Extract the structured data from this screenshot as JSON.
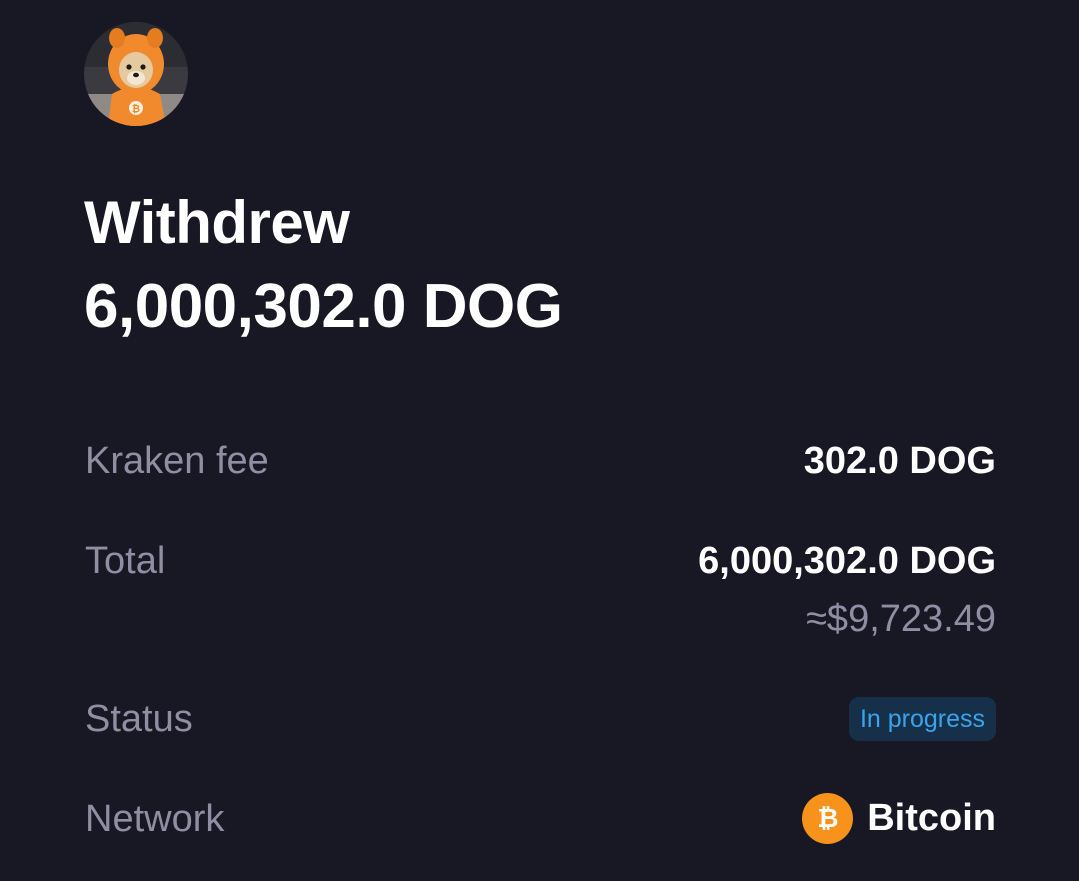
{
  "header": {
    "avatar_icon": "dog-in-orange-bitcoin-hoodie-avatar",
    "title": "Withdrew",
    "amount": "6,000,302.0 DOG"
  },
  "details": {
    "fee": {
      "label": "Kraken fee",
      "value": "302.0 DOG"
    },
    "total": {
      "label": "Total",
      "value": "6,000,302.0 DOG",
      "fiat": "≈$9,723.49"
    },
    "status": {
      "label": "Status",
      "value": "In progress",
      "color": "#3aa3ee"
    },
    "network": {
      "label": "Network",
      "value": "Bitcoin",
      "icon": "bitcoin-icon",
      "icon_color": "#f7931a"
    }
  },
  "colors": {
    "background": "#181724",
    "primary_text": "#ffffff",
    "secondary_text": "#8f8ea3",
    "badge_background": "#16304a"
  }
}
